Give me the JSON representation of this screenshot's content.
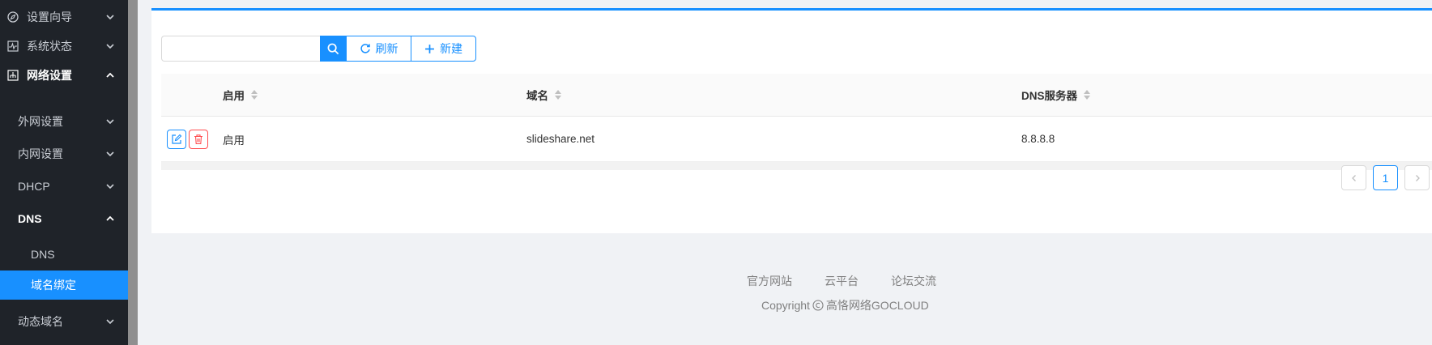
{
  "sidebar": {
    "items": [
      {
        "label": "设置向导",
        "icon": "compass-icon"
      },
      {
        "label": "系统状态",
        "icon": "pulse-icon"
      },
      {
        "label": "网络设置",
        "icon": "network-icon"
      },
      {
        "label": "外网设置"
      },
      {
        "label": "内网设置"
      },
      {
        "label": "DHCP"
      },
      {
        "label": "DNS"
      },
      {
        "label": "DNS"
      },
      {
        "label": "域名绑定"
      },
      {
        "label": "动态域名"
      }
    ]
  },
  "toolbar": {
    "search_value": "",
    "search_placeholder": "",
    "refresh_label": "刷新",
    "new_label": "新建"
  },
  "table": {
    "headers": [
      "启用",
      "域名",
      "DNS服务器"
    ],
    "rows": [
      {
        "enabled": "启用",
        "domain": "slideshare.net",
        "dns": "8.8.8.8"
      }
    ]
  },
  "pagination": {
    "current": "1"
  },
  "footer": {
    "links": [
      "官方网站",
      "云平台",
      "论坛交流"
    ],
    "copyright": "Copyright",
    "company": "高恪网络GOCLOUD"
  },
  "colors": {
    "accent": "#1890ff",
    "sidebar_bg": "#1f2329",
    "danger": "#ff4d4f"
  }
}
